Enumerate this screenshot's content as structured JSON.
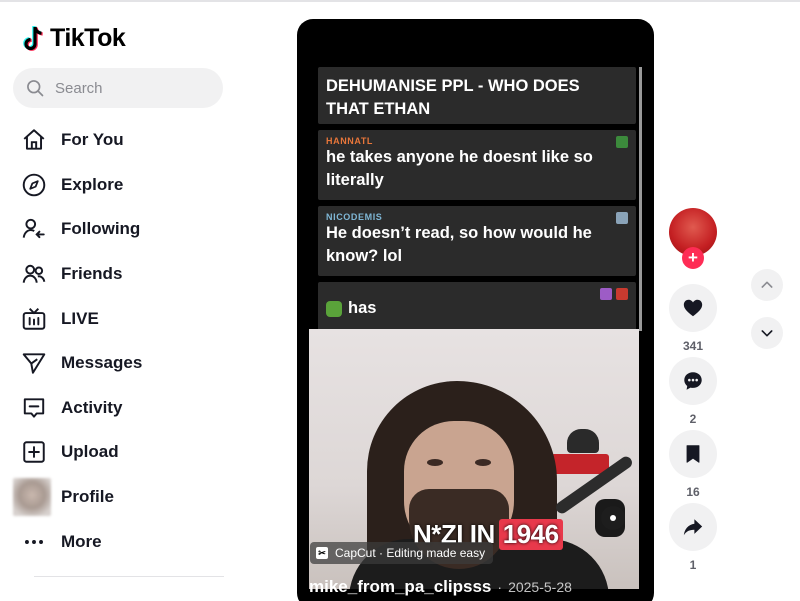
{
  "app": {
    "logo_text": "TikTok"
  },
  "search": {
    "placeholder": "Search"
  },
  "nav": {
    "items": [
      {
        "label": "For You",
        "icon": "home-icon"
      },
      {
        "label": "Explore",
        "icon": "compass-icon"
      },
      {
        "label": "Following",
        "icon": "following-icon"
      },
      {
        "label": "Friends",
        "icon": "friends-icon"
      },
      {
        "label": "LIVE",
        "icon": "live-tv-icon"
      },
      {
        "label": "Messages",
        "icon": "send-icon"
      },
      {
        "label": "Activity",
        "icon": "activity-icon"
      },
      {
        "label": "Upload",
        "icon": "upload-plus-icon"
      },
      {
        "label": "Profile",
        "icon": "profile-avatar"
      },
      {
        "label": "More",
        "icon": "more-dots-icon"
      }
    ]
  },
  "video": {
    "chat": [
      {
        "user": "",
        "text": "DEHUMANISE PPL - WHO DOES THAT ETHAN",
        "user_color": "#e6c229"
      },
      {
        "user": "HANNATL",
        "text": "he takes anyone he doesnt like so literally",
        "user_color": "#e8763a"
      },
      {
        "user": "NICODEMIS",
        "text": "He doesn’t read, so how would he know? lol",
        "user_color": "#7fb7d6"
      },
      {
        "user": "",
        "text": "has",
        "user_color": "#d6293a"
      }
    ],
    "overlay_caption": "N*ZI IN",
    "overlay_highlight": "1946",
    "capcut_label": "CapCut · Editing made easy",
    "author": "mike_from_pa_clipsss",
    "date_separator": "·",
    "date": "2025-5-28"
  },
  "actions": {
    "likes": "341",
    "comments": "2",
    "saves": "16",
    "shares": "1",
    "follow_symbol": "+"
  },
  "colors": {
    "accent": "#fe2c55",
    "text": "#161823",
    "muted": "#8a8b91",
    "pill_bg": "#f1f1f2"
  }
}
